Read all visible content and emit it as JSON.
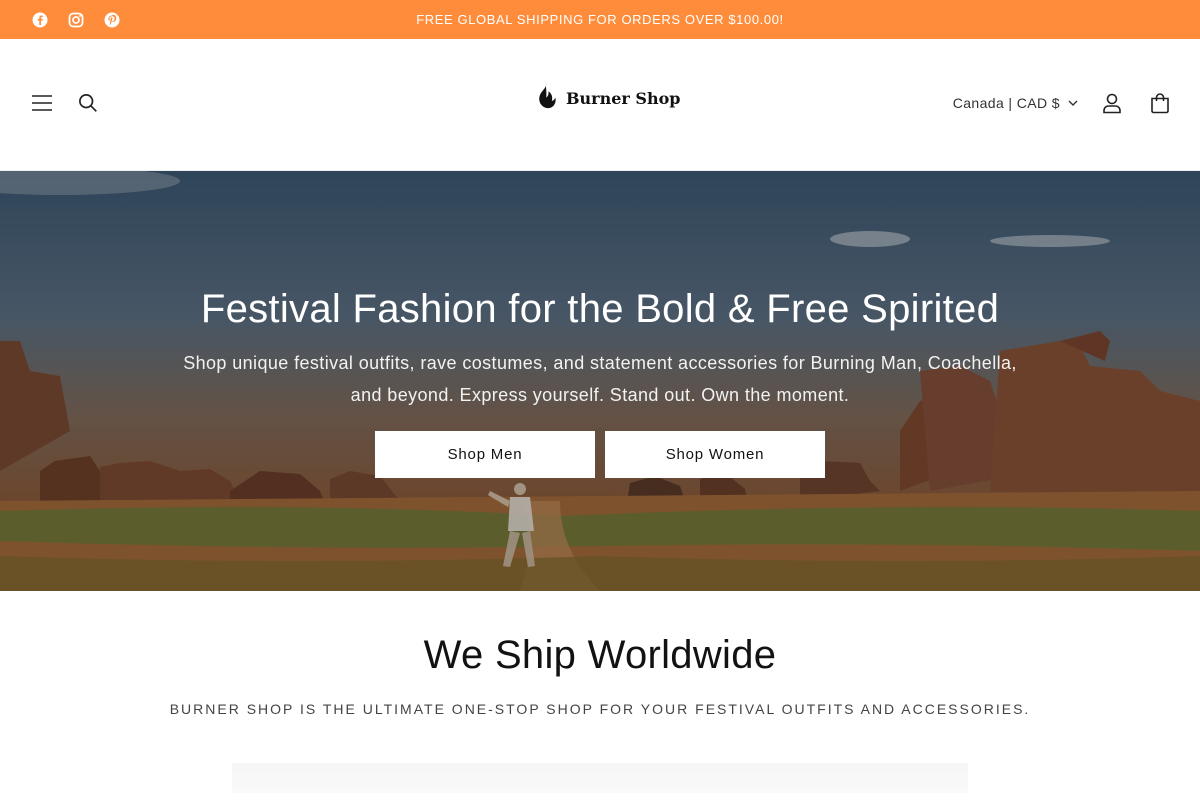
{
  "announcement": {
    "text": "FREE GLOBAL SHIPPING FOR ORDERS OVER $100.00!"
  },
  "socials": [
    {
      "icon": "facebook-icon"
    },
    {
      "icon": "instagram-icon"
    },
    {
      "icon": "pinterest-icon"
    }
  ],
  "header": {
    "logo_text": "Burner Shop",
    "country_selector": "Canada | CAD $",
    "icons": [
      "menu-icon",
      "search-icon",
      "account-icon",
      "cart-icon"
    ]
  },
  "hero": {
    "title": "Festival Fashion for the Bold & Free Spirited",
    "subtitle": "Shop unique festival outfits, rave costumes, and statement accessories for Burning Man, Coachella, and beyond. Express yourself. Stand out. Own the moment.",
    "buttons": [
      {
        "label": "Shop Men"
      },
      {
        "label": "Shop Women"
      }
    ]
  },
  "ship_section": {
    "title": "We Ship Worldwide",
    "subtitle": "BURNER SHOP IS THE ULTIMATE ONE-STOP SHOP FOR YOUR FESTIVAL OUTFITS AND ACCESSORIES."
  },
  "colors": {
    "accent": "#ff8c3b",
    "text": "#121212",
    "button_bg": "#ffffff"
  }
}
